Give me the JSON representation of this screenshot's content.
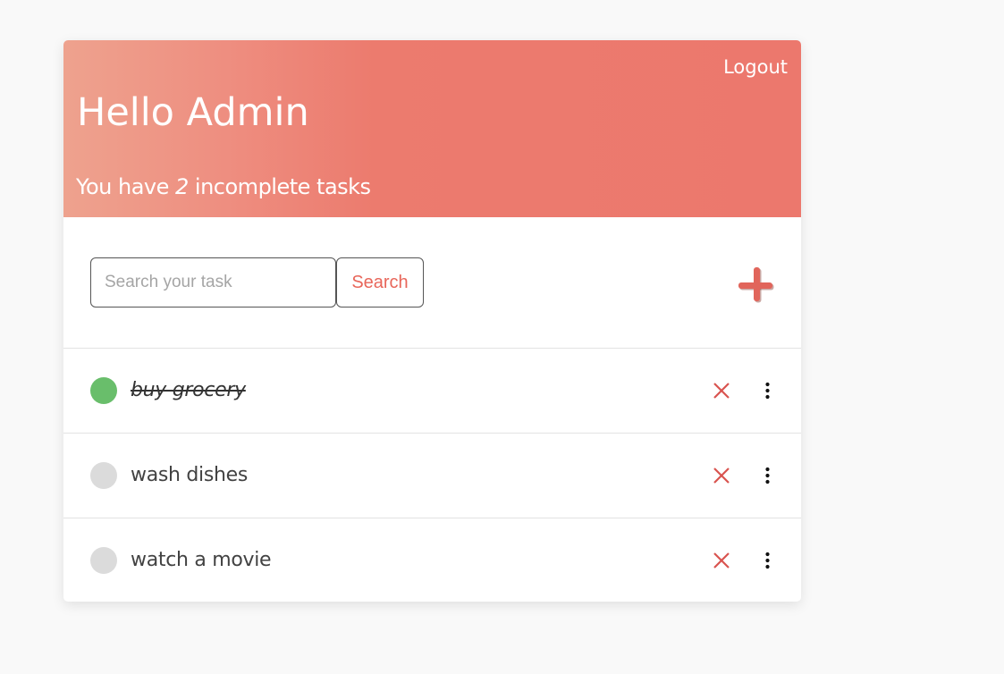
{
  "header": {
    "logout_label": "Logout",
    "greeting": "Hello Admin",
    "summary_prefix": "You have ",
    "incomplete_count": "2",
    "summary_suffix": " incomplete tasks"
  },
  "toolbar": {
    "search_placeholder": "Search your task",
    "search_value": "",
    "search_button_label": "Search",
    "add_icon": "plus-icon"
  },
  "tasks": [
    {
      "text": "buy grocery",
      "completed": true
    },
    {
      "text": "wash dishes",
      "completed": false
    },
    {
      "text": "watch a movie",
      "completed": false
    }
  ],
  "colors": {
    "accent": "#ec786d",
    "done_dot": "#69be6b",
    "pending_dot": "#dbdbdb",
    "delete_icon": "#d9534f"
  },
  "icons": {
    "delete": "close-icon",
    "more": "more-vertical-icon"
  }
}
